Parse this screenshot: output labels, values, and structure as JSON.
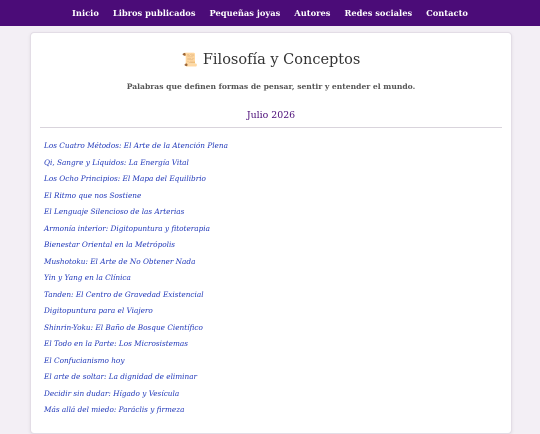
{
  "nav": {
    "items": [
      "Inicio",
      "Libros publicados",
      "Pequeñas joyas",
      "Autores",
      "Redes sociales",
      "Contacto"
    ]
  },
  "header": {
    "icon": "📜",
    "icon_name": "scroll-icon",
    "title": "Filosofía y Conceptos",
    "subtitle": "Palabras que definen formas de pensar, sentir y entender el mundo."
  },
  "section": {
    "month": "Julio 2026"
  },
  "articles": [
    "Los Cuatro Métodos: El Arte de la Atención Plena",
    "Qi, Sangre y Líquidos: La Energía Vital",
    "Los Ocho Principios: El Mapa del Equilibrio",
    "El Ritmo que nos Sostiene",
    "El Lenguaje Silencioso de las Arterias",
    "Armonía interior: Digitopuntura y fitoterapia",
    "Bienestar Oriental en la Metrópolis",
    "Mushotoku: El Arte de No Obtener Nada",
    "Yin y Yang en la Clínica",
    "Tanden: El Centro de Gravedad Existencial",
    "Digitopuntura para el Viajero",
    "Shinrin-Yoku: El Baño de Bosque Científico",
    "El Todo en la Parte: Los Microsistemas",
    "El Confucianismo hoy",
    "El arte de soltar: La dignidad de eliminar",
    "Decidir sin dudar: Hígado y Vesícula",
    "Más allá del miedo: Paráclis y firmeza"
  ],
  "colors": {
    "nav_bg": "#4b0c78",
    "link": "#1e36b8",
    "page_bg": "#f3eff5"
  }
}
